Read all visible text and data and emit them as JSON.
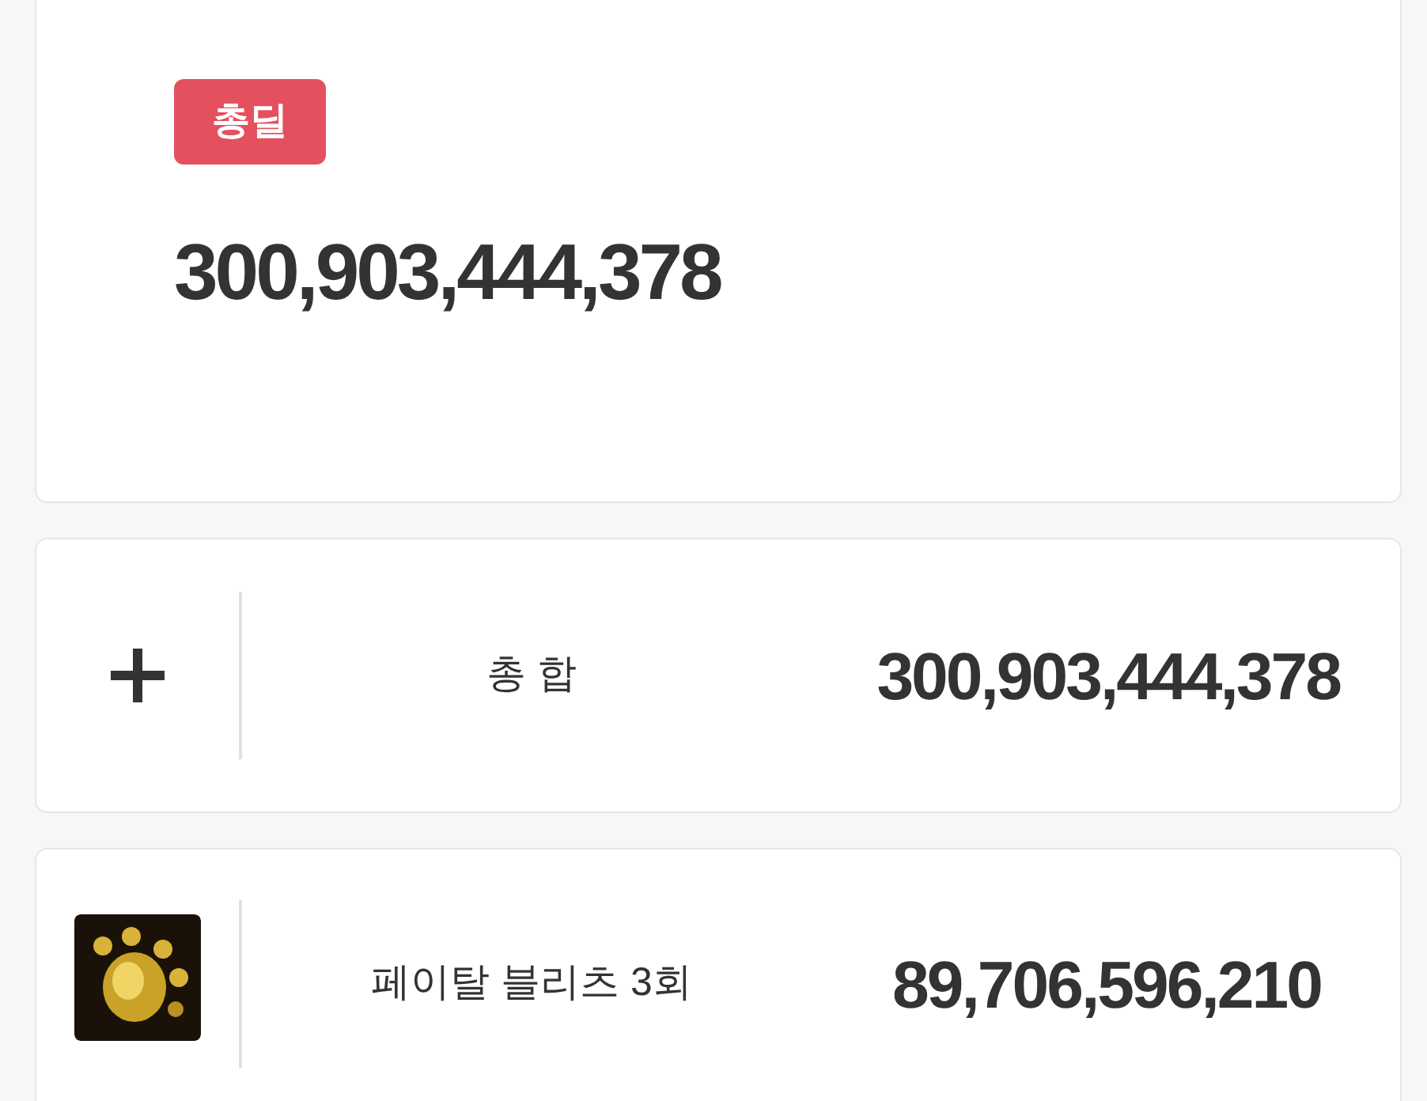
{
  "total_card": {
    "badge": "총딜",
    "value": "300,903,444,378"
  },
  "rows": [
    {
      "kind": "sum",
      "label": "총 합",
      "value": "300,903,444,378"
    },
    {
      "kind": "skill",
      "label": "페이탈 블리츠 3회",
      "value": "89,706,596,210"
    }
  ]
}
